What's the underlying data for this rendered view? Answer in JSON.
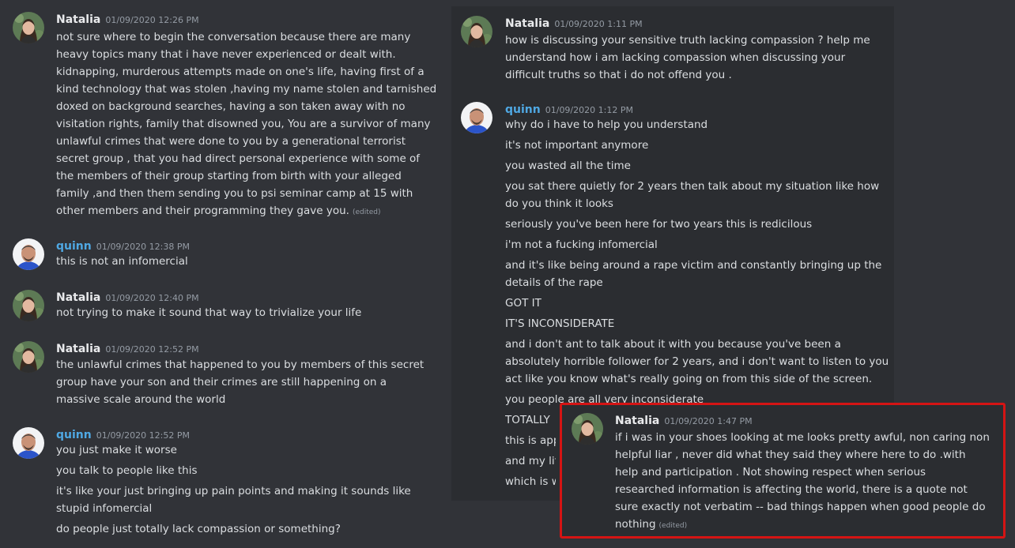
{
  "left": [
    {
      "author": "Natalia",
      "avatar": "natalia",
      "timestamp": "01/09/2020 12:26 PM",
      "lines": [
        "not sure where to begin the conversation because there are many",
        "heavy topics many that  i have never experienced or dealt with.",
        "kidnapping, murderous attempts made on one's life,  having first of a",
        "kind technology that was stolen ,having my name stolen and tarnished",
        "doxed on background searches, having a son  taken away with no",
        "visitation rights, family that disowned you,  You  are a  survivor of many",
        "unlawful crimes that were done to you by  a generational terrorist",
        "secret group , that you  had direct personal experience with  some of",
        "the members of their  group  starting  from birth with your alleged",
        "family  ,and then them sending you to psi seminar camp  at 15 with",
        "other members and their programming they gave you."
      ],
      "edited": "(edited)"
    },
    {
      "author": "quinn",
      "avatar": "quinn",
      "timestamp": "01/09/2020 12:38 PM",
      "lines": [
        "this is not an infomercial"
      ]
    },
    {
      "author": "Natalia",
      "avatar": "natalia",
      "timestamp": "01/09/2020 12:40 PM",
      "lines": [
        "not trying to make it sound that way  to trivialize your life"
      ]
    },
    {
      "author": "Natalia",
      "avatar": "natalia",
      "timestamp": "01/09/2020 12:52 PM",
      "lines": [
        "the unlawful crimes that happened to you by  members of this  secret",
        "group  have your son  and their crimes are still  happening on a",
        "massive scale around the world"
      ]
    },
    {
      "author": "quinn",
      "avatar": "quinn",
      "timestamp": "01/09/2020 12:52 PM",
      "lines": [
        "you just make it worse",
        "you talk to people like this",
        "it's like your just bringing up pain points and making it sounds like",
        "stupid infomercial",
        "do people just totally lack compassion or something?"
      ]
    }
  ],
  "right": [
    {
      "author": "Natalia",
      "avatar": "natalia",
      "timestamp": "01/09/2020 1:11 PM",
      "lines": [
        "how is  discussing your  sensitive truth lacking compassion ? help me",
        "understand how i am lacking compassion  when discussing your",
        "difficult truths so that i do not  offend  you ."
      ]
    },
    {
      "author": "quinn",
      "avatar": "quinn",
      "timestamp": "01/09/2020 1:12 PM",
      "lines": [
        "why do i have to help you understand",
        "it's not important anymore",
        "you wasted all the time",
        "you sat there quietly for 2 years then talk about my situation like how",
        "do you think it looks",
        "seriously you've been here for two years this is redicilous",
        "i'm not a fucking infomercial",
        "and it's like being around a rape victim and constantly bringing up the",
        "details of the rape",
        "GOT IT",
        "IT'S INCONSIDERATE",
        "and i don't ant to talk about it with you because you've been a",
        "absolutely horrible follower for 2 years, and i don't want to listen to you",
        "act like you know what's really going on from this side of the screen.",
        "you people are all very inconsiderate",
        "TOTALLY",
        "this is app",
        "and my life",
        "which is w"
      ]
    }
  ],
  "highlight": {
    "author": "Natalia",
    "avatar": "natalia",
    "timestamp": "01/09/2020 1:47 PM",
    "lines": [
      "if i was in your shoes looking at me  looks pretty  awful,  non caring non",
      "helpful  liar , never did  what  they said they where here to do .with",
      "help and  participation .   Not showing  respect  when   serious",
      "researched information  is  affecting the world,   there is a quote not",
      "sure exactly  not verbatim -- bad things happen when good people do",
      "nothing"
    ],
    "edited": "(edited)"
  },
  "colors": {
    "accent_quinn": "#4fa8e3",
    "highlight_border": "#d51414"
  }
}
